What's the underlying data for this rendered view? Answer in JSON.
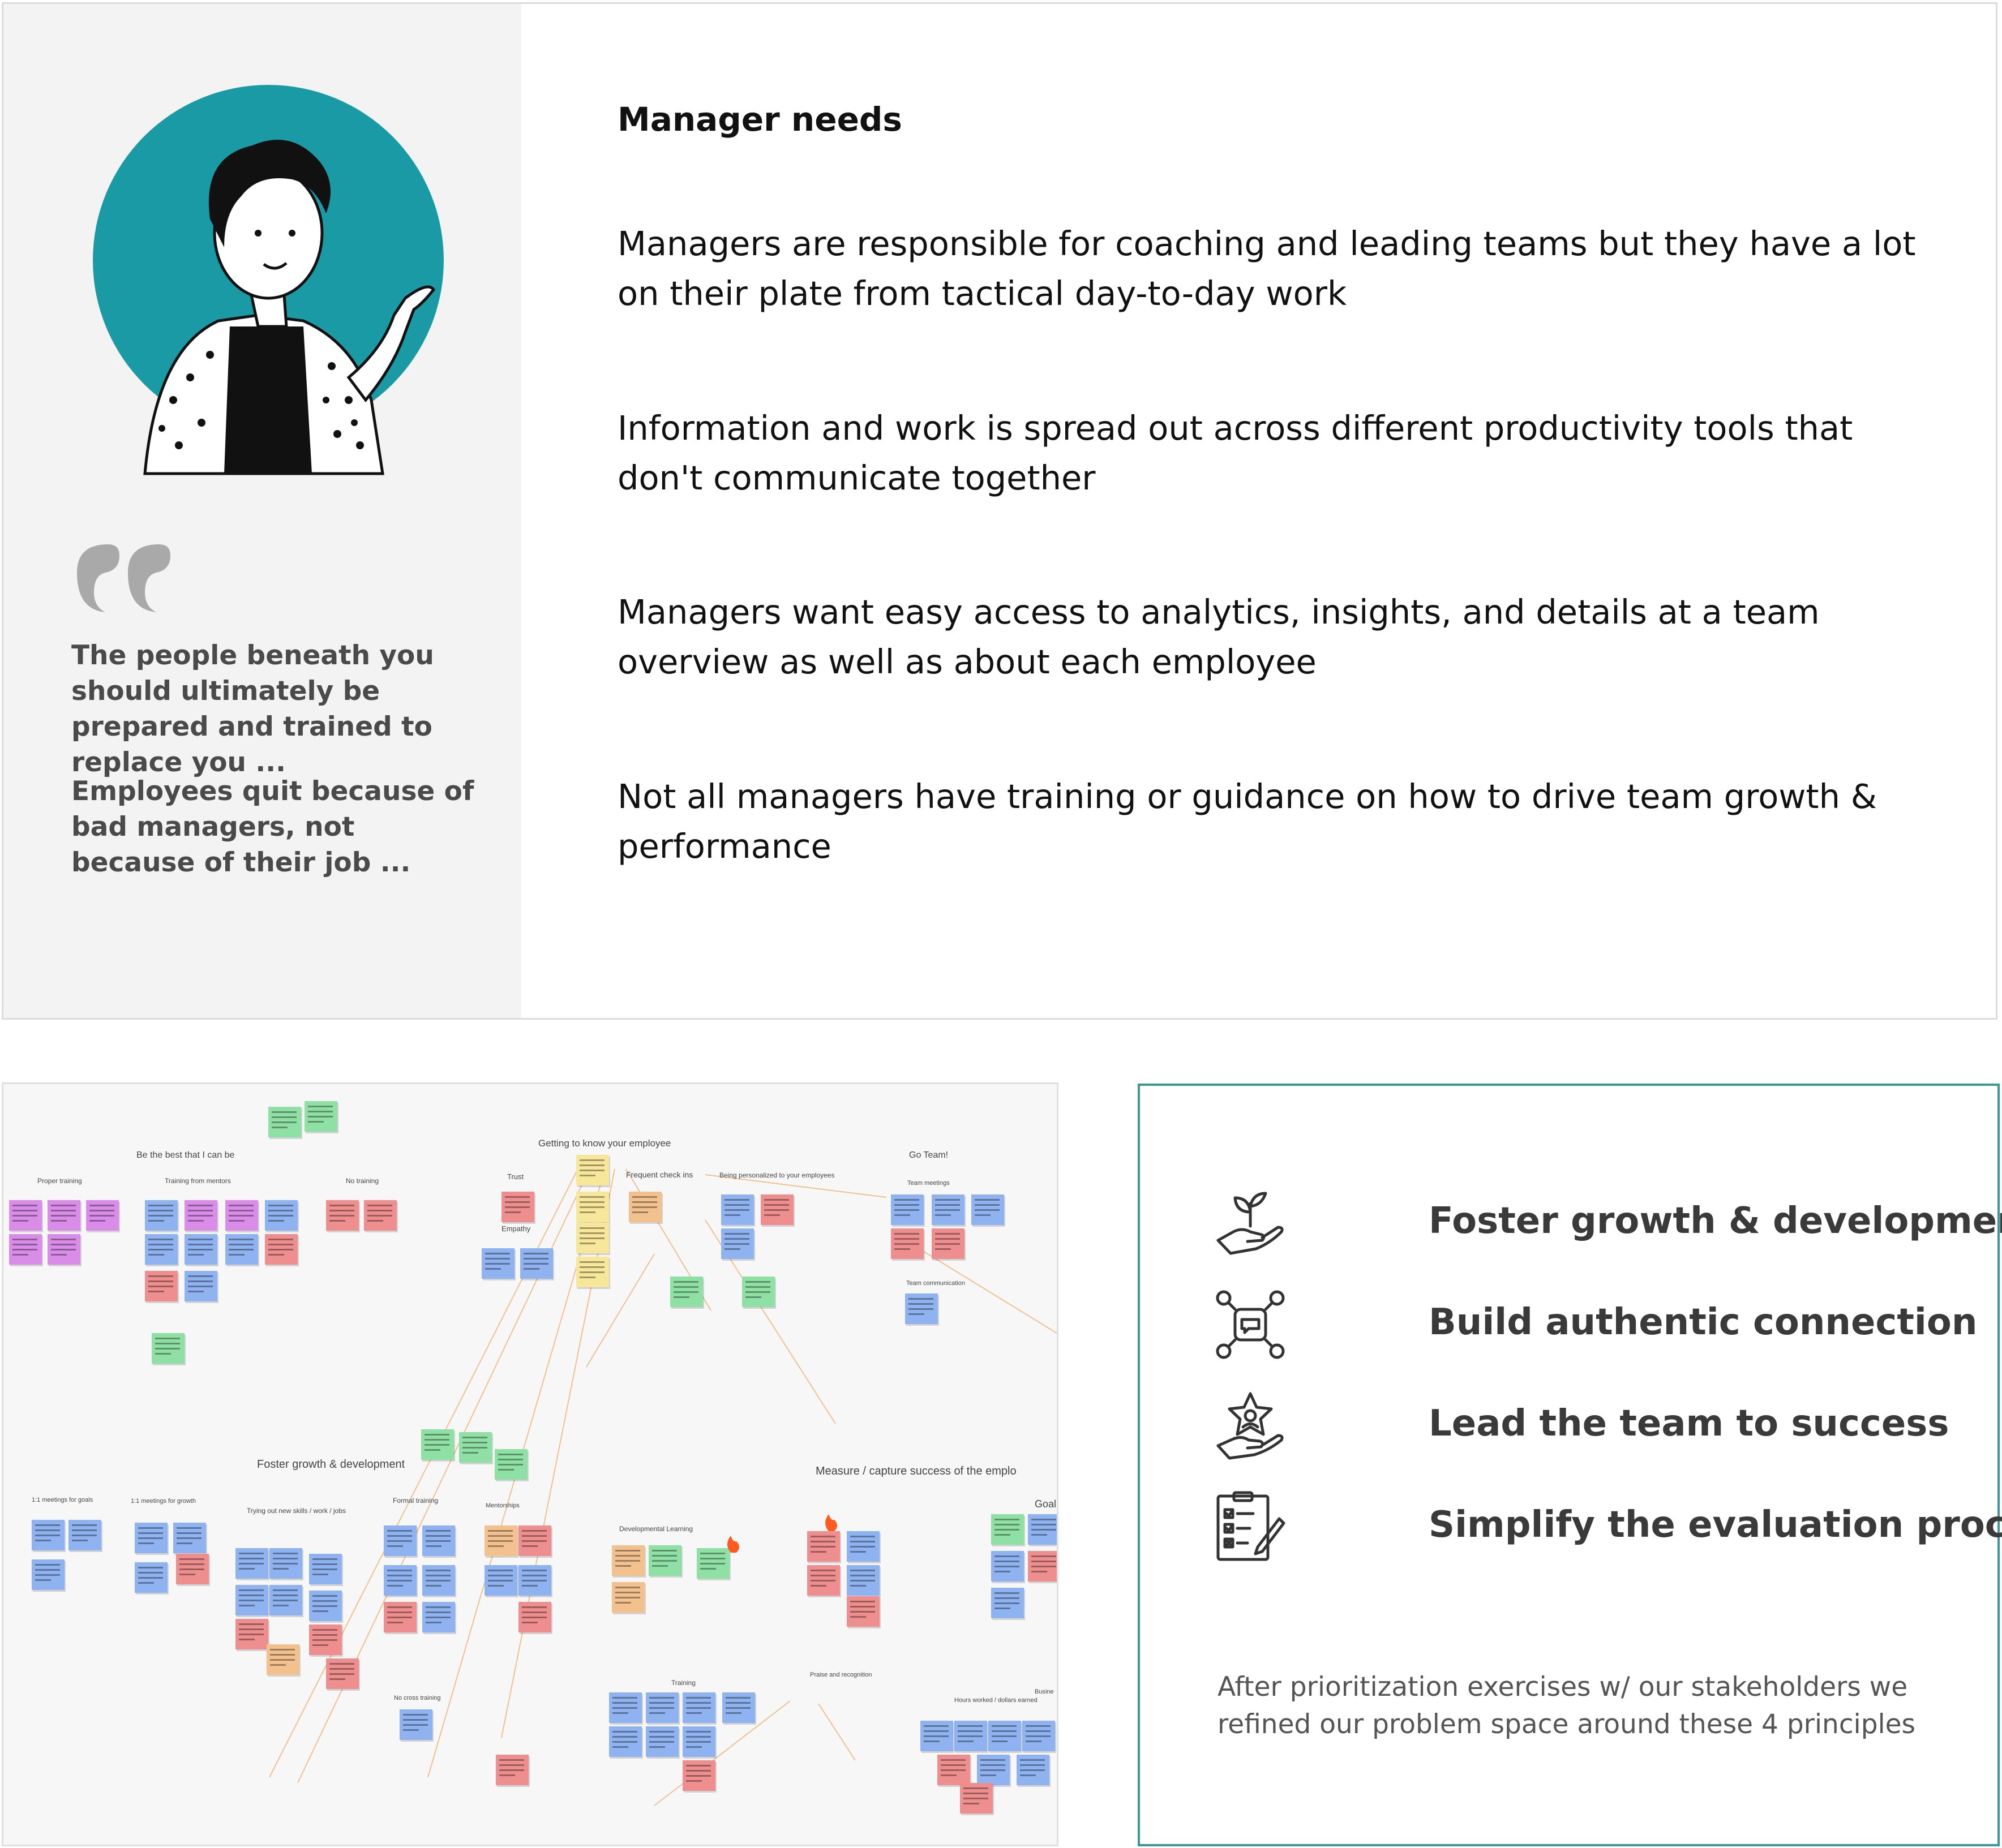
{
  "persona": {
    "quotes": [
      "The people beneath you should ultimately be prepared and trained to replace you ...",
      "Employees quit because of bad managers, not because of their job ..."
    ]
  },
  "manager_needs": {
    "heading": "Manager needs",
    "items": [
      "Managers are responsible for coaching and leading teams but they have a lot on their plate from tactical day-to-day work",
      "Information and work is spread out across different productivity tools that don't communicate together",
      "Managers want easy access to analytics, insights, and details at a team overview as well as about each employee",
      "Not all managers have training or guidance on how to drive team growth & performance"
    ]
  },
  "affinity_board": {
    "clusters": [
      "Be the best that I can be",
      "Proper training",
      "Training from mentors",
      "No training",
      "Getting to know your employee",
      "Trust",
      "Empathy",
      "Frequent check ins",
      "Being personalized to your employees",
      "Go Team!",
      "Team meetings",
      "Team communication",
      "Foster growth & development",
      "1:1 meetings for goals",
      "1:1 meetings for growth",
      "Trying out new skills / work / jobs",
      "Formal training",
      "Mentorships",
      "No cross training",
      "Measure / capture success of the emplo",
      "Developmental Learning",
      "Training",
      "Praise and recognition",
      "Hours worked / dollars earned",
      "Goal",
      "Busine"
    ],
    "note_colors": {
      "blue": "#8eb3f0",
      "pink": "#ee8e8e",
      "purple": "#d98ce8",
      "green": "#8fe0a5",
      "yellow": "#f7e79a",
      "orange": "#f2c18d"
    }
  },
  "principles": {
    "items": [
      {
        "icon": "hand-plant-icon",
        "label": "Foster growth & development"
      },
      {
        "icon": "network-chat-icon",
        "label": "Build authentic connection"
      },
      {
        "icon": "hand-star-icon",
        "label": "Lead the team to success"
      },
      {
        "icon": "checklist-clipboard-icon",
        "label": "Simplify the evaluation process"
      }
    ],
    "closing": "After prioritization exercises w/ our stakeholders we refined our problem space around these 4 principles"
  }
}
